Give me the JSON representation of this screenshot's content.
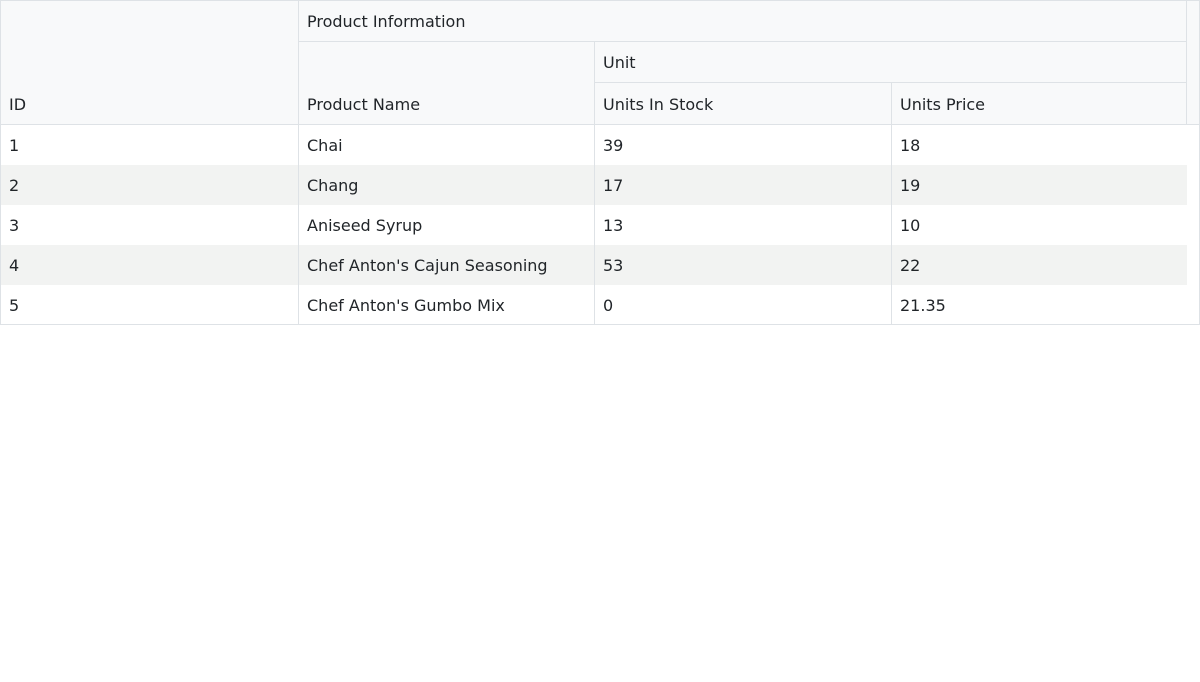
{
  "grid": {
    "headers": {
      "group_product_information": "Product Information",
      "group_unit": "Unit",
      "id": "ID",
      "product_name": "Product Name",
      "units_in_stock": "Units In Stock",
      "units_price": "Units Price"
    },
    "rows": [
      {
        "id": "1",
        "product_name": "Chai",
        "units_in_stock": "39",
        "units_price": "18"
      },
      {
        "id": "2",
        "product_name": "Chang",
        "units_in_stock": "17",
        "units_price": "19"
      },
      {
        "id": "3",
        "product_name": "Aniseed Syrup",
        "units_in_stock": "13",
        "units_price": "10"
      },
      {
        "id": "4",
        "product_name": "Chef Anton's Cajun Seasoning",
        "units_in_stock": "53",
        "units_price": "22"
      },
      {
        "id": "5",
        "product_name": "Chef Anton's Gumbo Mix",
        "units_in_stock": "0",
        "units_price": "21.35"
      }
    ]
  },
  "colors": {
    "header_bg": "#f8f9fa",
    "border": "#dee2e6",
    "alt_row_bg": "#f2f3f2",
    "text": "#212529"
  }
}
